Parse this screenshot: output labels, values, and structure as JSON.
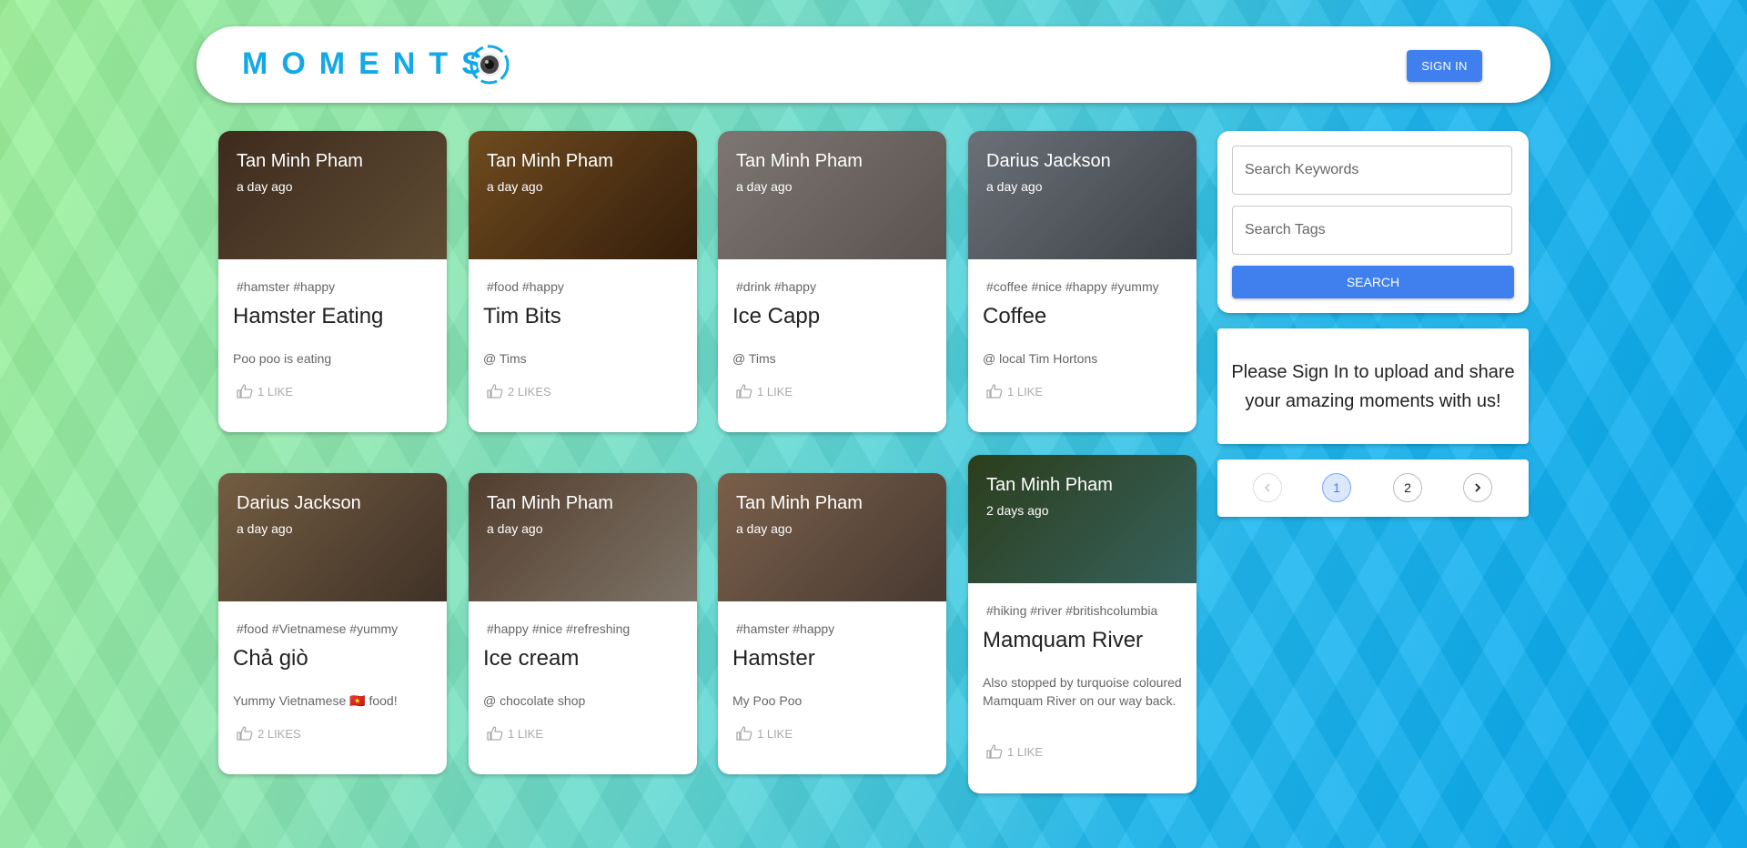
{
  "header": {
    "brand": "MOMENTS",
    "sign_in": "SIGN IN"
  },
  "posts": [
    {
      "author": "Tan Minh Pham",
      "time": "a day ago",
      "tags": "#hamster #happy",
      "title": "Hamster Eating",
      "message": "Poo poo is eating",
      "likes": "1 LIKE",
      "image_colors": [
        "#6b4a32",
        "#a4835a"
      ]
    },
    {
      "author": "Tan Minh Pham",
      "time": "a day ago",
      "tags": "#food #happy",
      "title": "Tim Bits",
      "message": "@ Tims",
      "likes": "2 LIKES",
      "image_colors": [
        "#c08236",
        "#5b3414"
      ]
    },
    {
      "author": "Tan Minh Pham",
      "time": "a day ago",
      "tags": "#drink #happy",
      "title": "Ice Capp",
      "message": "@ Tims",
      "likes": "1 LIKE",
      "image_colors": [
        "#d7ccc4",
        "#9b8f8b"
      ]
    },
    {
      "author": "Darius Jackson",
      "time": "a day ago",
      "tags": "#coffee #nice #happy #yummy",
      "title": "Coffee",
      "message": "@ local Tim Hortons",
      "likes": "1 LIKE",
      "image_colors": [
        "#b9c2cf",
        "#6a737f"
      ]
    },
    {
      "author": "Darius Jackson",
      "time": "a day ago",
      "tags": "#food #Vietnamese #yummy",
      "title": "Chả giò",
      "message": "Yummy Vietnamese 🇻🇳 food!",
      "likes": "2 LIKES",
      "image_colors": [
        "#c7a072",
        "#6d5644"
      ]
    },
    {
      "author": "Tan Minh Pham",
      "time": "a day ago",
      "tags": "#happy #nice #refreshing",
      "title": "Ice cream",
      "message": "@ chocolate shop",
      "likes": "1 LIKE",
      "image_colors": [
        "#8e6a4e",
        "#d8c8b4"
      ]
    },
    {
      "author": "Tan Minh Pham",
      "time": "a day ago",
      "tags": "#hamster #happy",
      "title": "Hamster",
      "message": "My Poo Poo",
      "likes": "1 LIKE",
      "image_colors": [
        "#d4a682",
        "#7b6355"
      ]
    },
    {
      "author": "Tan Minh Pham",
      "time": "2 days ago",
      "tags": "#hiking #river #britishcolumbia",
      "title": "Mamquam River",
      "message": "Also stopped by turquoise coloured Mamquam River on our way back.",
      "likes": "1 LIKE",
      "image_colors": [
        "#4b6b2f",
        "#5fa8a0"
      ]
    }
  ],
  "search": {
    "keywords_placeholder": "Search Keywords",
    "tags_placeholder": "Search Tags",
    "button": "SEARCH"
  },
  "notice": "Please Sign In to upload and share your amazing moments with us!",
  "pagination": {
    "pages": [
      "1",
      "2"
    ],
    "current": "1"
  },
  "colors": {
    "accent": "#3f80ee",
    "brand": "#14a9e6"
  }
}
